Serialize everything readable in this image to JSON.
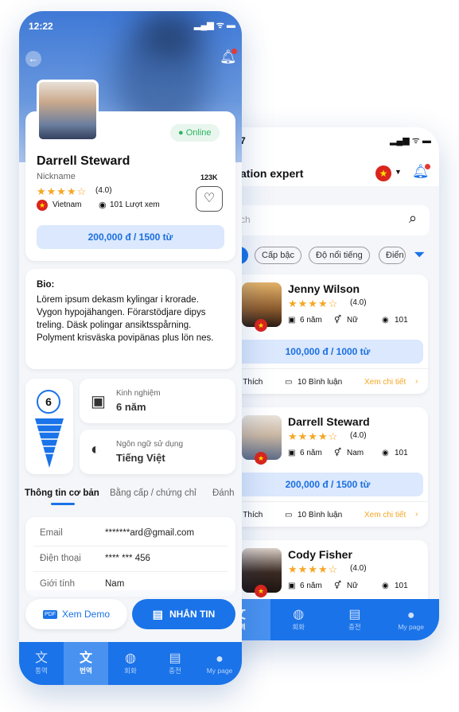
{
  "back": {
    "time": "7",
    "title": "ation expert",
    "search_placeholder": "ch",
    "filters": [
      "Cấp bậc",
      "Độ nổi tiếng",
      "Điển"
    ],
    "cards": [
      {
        "name": "Jenny Wilson",
        "rating": "(4.0)",
        "exp": "6 năm",
        "gender": "Nữ",
        "views": "101",
        "price": "100,000 đ / 1000 từ"
      },
      {
        "name": "Darrell Steward",
        "rating": "(4.0)",
        "exp": "6 năm",
        "gender": "Nam",
        "views": "101",
        "price": "200,000 đ / 1500 từ"
      },
      {
        "name": "Cody Fisher",
        "rating": "(4.0)",
        "exp": "6 năm",
        "gender": "Nữ",
        "views": "101"
      }
    ],
    "footer_rows": [
      {
        "likes": "K Thích",
        "comments": "10 Bình luận",
        "detail": "Xem chi tiết"
      },
      {
        "likes": "K Thích",
        "comments": "10 Bình luận",
        "detail": "Xem chi tiết"
      }
    ],
    "tabs": [
      {
        "label": "번역",
        "icon": "translate-icon",
        "active": true
      },
      {
        "label": "회화",
        "icon": "chat-icon",
        "active": false
      },
      {
        "label": "충전",
        "icon": "wallet-icon",
        "active": false
      },
      {
        "label": "My page",
        "icon": "user-icon",
        "active": false
      }
    ]
  },
  "front": {
    "time": "12:22",
    "online": "Online",
    "name": "Darrell Steward",
    "nickname": "Nickname",
    "likes_count": "123K",
    "rating": "(4.0)",
    "country": "Vietnam",
    "views": "101 Lượt xem",
    "price": "200,000 đ / 1500 từ",
    "bio_label": "Bio:",
    "bio_text": "Lörem ipsum dekasm kylingar i krorade. Vygon hypojähangen. Förarstödjare dipys treling. Däsk polingar ansiktsspårning. Polyment krisväska povipänas plus lön nes.",
    "level": "6",
    "experience_label": "Kinh nghiệm",
    "experience_value": "6 năm",
    "language_label": "Ngôn ngữ sử dụng",
    "language_value": "Tiếng Việt",
    "info_tabs": [
      "Thông tin cơ bản",
      "Bằng cấp / chứng chỉ",
      "Đánh"
    ],
    "info": [
      {
        "key": "Email",
        "value": "*******ard@gmail.com"
      },
      {
        "key": "Điện thoại",
        "value": "**** *** 456"
      },
      {
        "key": "Giới tính",
        "value": "Nam"
      }
    ],
    "demo_button": "Xem Demo",
    "message_button": "NHẮN TIN",
    "tabs": [
      {
        "label": "통역",
        "icon": "interpret-icon"
      },
      {
        "label": "번역",
        "icon": "translate-icon",
        "active": true
      },
      {
        "label": "회화",
        "icon": "chat-icon"
      },
      {
        "label": "충전",
        "icon": "wallet-icon"
      },
      {
        "label": "My page",
        "icon": "user-icon"
      }
    ]
  },
  "colors": {
    "primary": "#1a73e8",
    "online": "#2bb55e",
    "star": "#f5a623",
    "detail_link": "#f5a623"
  }
}
